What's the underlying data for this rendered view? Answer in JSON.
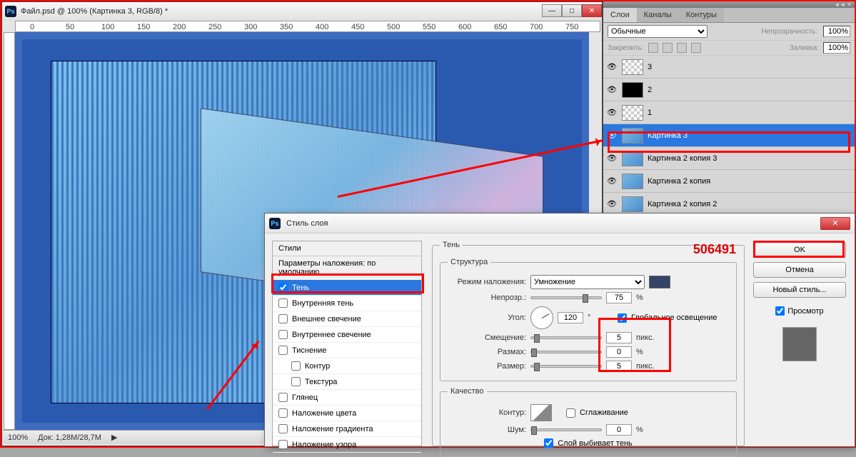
{
  "doc_window": {
    "title": "Файл.psd @ 100% (Картинка 3, RGB/8) *",
    "zoom": "100%",
    "doc_info": "Док: 1,28M/28,7M",
    "ruler_marks": [
      "0",
      "50",
      "100",
      "150",
      "200",
      "250",
      "300",
      "350",
      "400",
      "450",
      "500",
      "550",
      "600",
      "650",
      "700",
      "750"
    ]
  },
  "layers_panel": {
    "tabs": [
      "Слои",
      "Каналы",
      "Контуры"
    ],
    "blend_mode": "Обычные",
    "opacity_label": "Непрозрачность:",
    "opacity_value": "100%",
    "lock_label": "Закрепить:",
    "fill_label": "Заливка:",
    "fill_value": "100%",
    "layers": [
      {
        "name": "3",
        "thumb": "checker"
      },
      {
        "name": "2",
        "thumb": "black"
      },
      {
        "name": "1",
        "thumb": "checker"
      },
      {
        "name": "Картинка 3",
        "thumb": "blue",
        "selected": true
      },
      {
        "name": "Картинка 2 копия 3",
        "thumb": "blue"
      },
      {
        "name": "Картинка 2 копия",
        "thumb": "blue"
      },
      {
        "name": "Картинка 2 копия 2",
        "thumb": "blue"
      }
    ]
  },
  "dialog": {
    "title": "Стиль слоя",
    "watermark": "506491",
    "styles_header": "Стили",
    "styles": {
      "params": "Параметры наложения: по умолчанию",
      "drop_shadow": "Тень",
      "inner_shadow": "Внутренняя тень",
      "outer_glow": "Внешнее свечение",
      "inner_glow": "Внутреннее свечение",
      "bevel": "Тиснение",
      "contour": "Контур",
      "texture": "Текстура",
      "satin": "Глянец",
      "color_overlay": "Наложение цвета",
      "gradient_overlay": "Наложение градиента",
      "pattern_overlay": "Наложение узора"
    },
    "shadow": {
      "group_title": "Тень",
      "structure_title": "Структура",
      "blend_label": "Режим наложения:",
      "blend_value": "Умножение",
      "opacity_label": "Непрозр.:",
      "opacity_value": "75",
      "opacity_unit": "%",
      "angle_label": "Угол:",
      "angle_value": "120",
      "angle_unit": "°",
      "global_light": "Глобальное освещение",
      "distance_label": "Смещение:",
      "distance_value": "5",
      "distance_unit": "пикс.",
      "spread_label": "Размах:",
      "spread_value": "0",
      "spread_unit": "%",
      "size_label": "Размер:",
      "size_value": "5",
      "size_unit": "пикс.",
      "quality_title": "Качество",
      "contour_label": "Контур:",
      "antialias": "Сглаживание",
      "noise_label": "Шум:",
      "noise_value": "0",
      "noise_unit": "%",
      "knockout": "Слой выбивает тень"
    },
    "buttons": {
      "ok": "OK",
      "cancel": "Отмена",
      "new_style": "Новый стиль...",
      "preview": "Просмотр"
    }
  }
}
